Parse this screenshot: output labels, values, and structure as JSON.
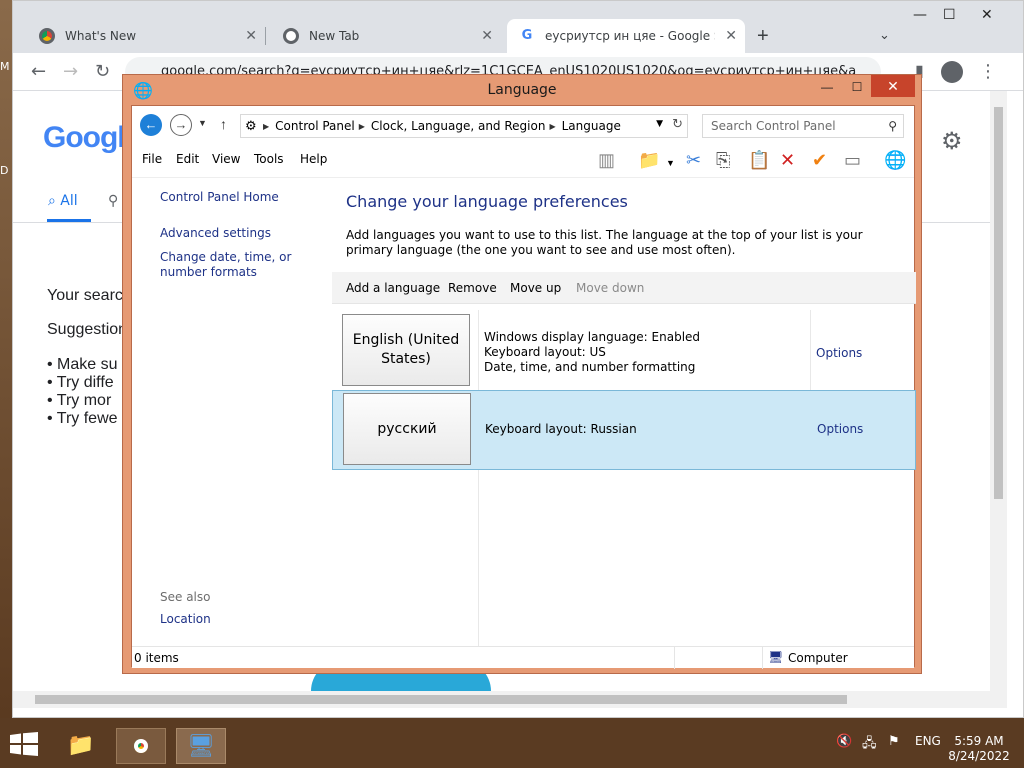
{
  "browser": {
    "tabs": [
      {
        "title": "What's New",
        "icon": "chrome-icon"
      },
      {
        "title": "New Tab",
        "icon": "chrome-icon"
      },
      {
        "title": "еусриутср ин цяе - Google Sear",
        "icon": "google-icon"
      }
    ],
    "url": "google.com/search?q=еусриутср+ин+цяе&rlz=1C1GCEA_enUS1020US1020&oq=еусриутср+ин+цяе&a",
    "new_tab_label": "+"
  },
  "google": {
    "logo": "Googl",
    "tab_all": "All",
    "your_search": "Your searc",
    "suggestions": "Suggestion",
    "bullets": [
      "Make su",
      "Try diffe",
      "Try mor",
      "Try fewe"
    ]
  },
  "desktop": {
    "left_chars": [
      "M",
      "D"
    ]
  },
  "window": {
    "title": "Language",
    "breadcrumbs": [
      "Control Panel",
      "Clock, Language, and Region",
      "Language"
    ],
    "search_placeholder": "Search Control Panel",
    "menu": [
      "File",
      "Edit",
      "View",
      "Tools",
      "Help"
    ],
    "sidebar": {
      "home": "Control Panel Home",
      "advanced": "Advanced settings",
      "datetime": "Change date, time, or number formats",
      "see_also": "See also",
      "location": "Location"
    },
    "main": {
      "title": "Change your language preferences",
      "description": "Add languages you want to use to this list. The language at the top of your list is your primary language (the one you want to see and use most often).",
      "commands": {
        "add": "Add a language",
        "remove": "Remove",
        "move_up": "Move up",
        "move_down": "Move down"
      }
    },
    "languages": [
      {
        "name": "English (United States)",
        "lines": [
          "Windows display language: Enabled",
          "Keyboard layout: US",
          "Date, time, and number formatting"
        ],
        "options": "Options",
        "selected": false
      },
      {
        "name": "русский",
        "lines": [
          "Keyboard layout: Russian"
        ],
        "options": "Options",
        "selected": true
      }
    ],
    "status": {
      "items": "0 items",
      "location": "Computer"
    }
  },
  "taskbar": {
    "language": "ENG",
    "time": "5:59 AM",
    "date": "8/24/2022"
  },
  "colors": {
    "accent": "#1e80d8",
    "window_frame": "#e69a74",
    "close_red": "#c7442b",
    "link": "#1e3287",
    "selection": "#cce8f6"
  }
}
